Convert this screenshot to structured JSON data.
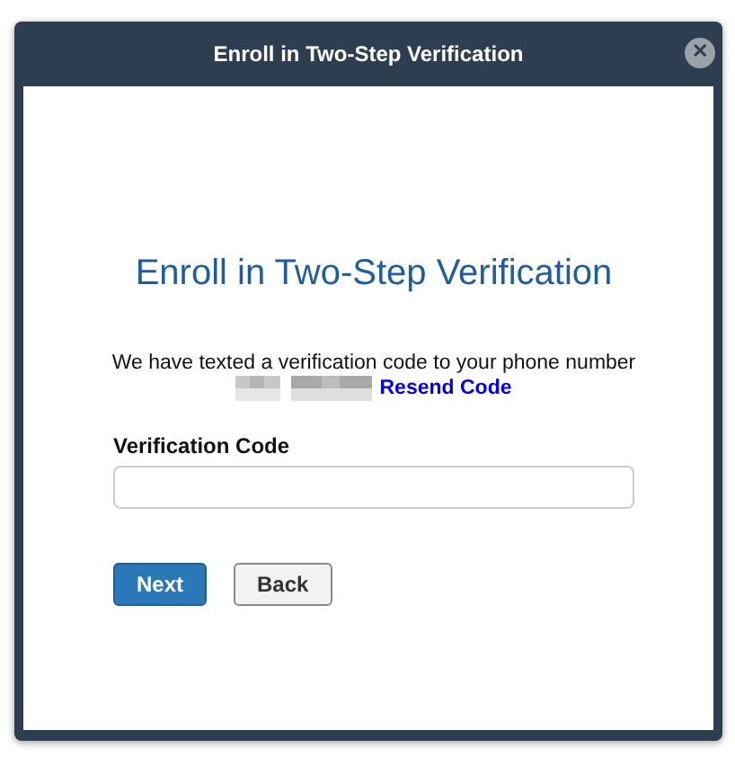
{
  "window": {
    "title": "Enroll in Two-Step Verification",
    "close_icon": "✕"
  },
  "heading": "Enroll in Two-Step Verification",
  "message": "We have texted a verification code to your phone number",
  "resend_link": "Resend Code",
  "field": {
    "label": "Verification Code"
  },
  "buttons": [
    {
      "label": "Next",
      "kind": "primary"
    },
    {
      "label": "Back",
      "kind": "secondary"
    }
  ]
}
